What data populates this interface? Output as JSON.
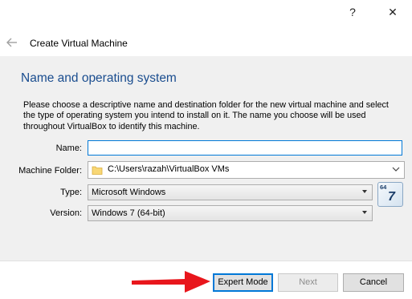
{
  "window": {
    "help_label": "?",
    "close_label": "✕"
  },
  "header": {
    "title": "Create Virtual Machine"
  },
  "section": {
    "title": "Name and operating system",
    "description": "Please choose a descriptive name and destination folder for the new virtual machine and select the type of operating system you intend to install on it. The name you choose will be used throughout VirtualBox to identify this machine."
  },
  "form": {
    "name_label": "Name:",
    "name_value": "",
    "folder_label": "Machine Folder:",
    "folder_value": "C:\\Users\\razah\\VirtualBox VMs",
    "type_label": "Type:",
    "type_value": "Microsoft Windows",
    "version_label": "Version:",
    "version_value": "Windows 7 (64-bit)",
    "os_icon_bits": "64",
    "os_icon_version": "7"
  },
  "buttons": {
    "expert": "Expert Mode",
    "next": "Next",
    "cancel": "Cancel"
  },
  "colors": {
    "accent": "#0078d7",
    "section_title": "#1a4d8f",
    "annotation_arrow": "#e8161c"
  }
}
